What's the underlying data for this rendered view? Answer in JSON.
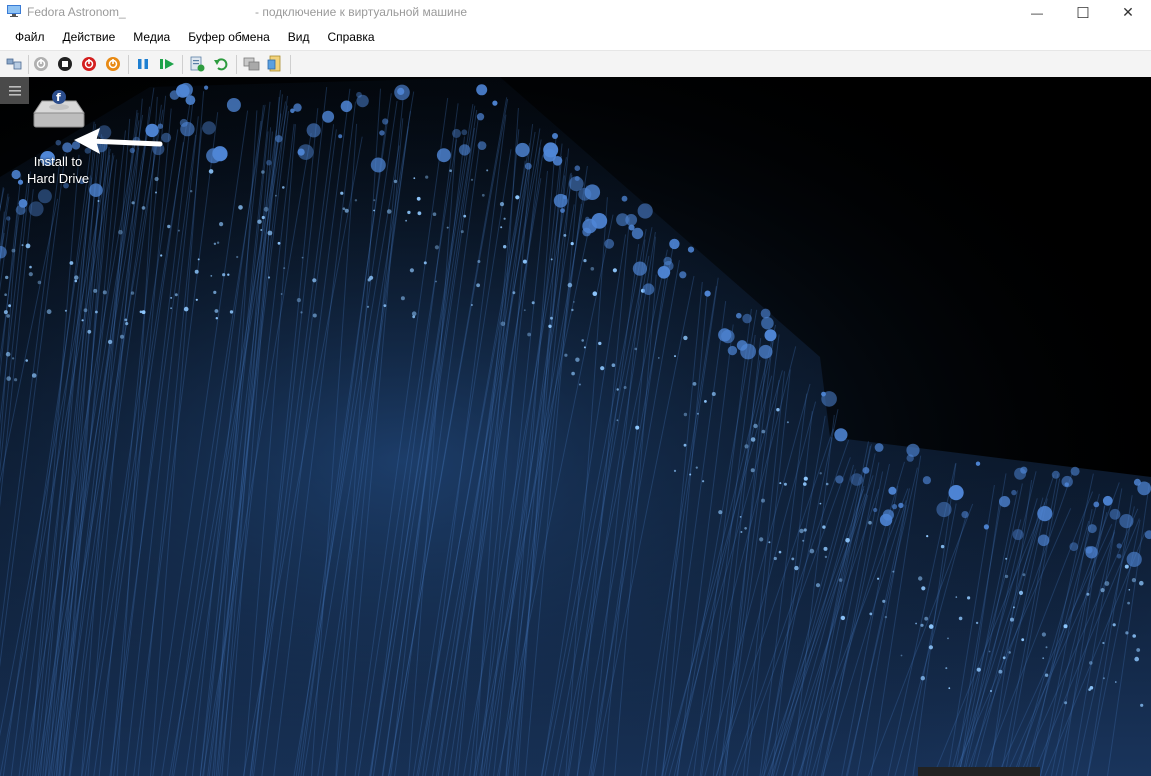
{
  "window": {
    "title_main": "Fedora Astronom_",
    "title_sub": "- подключение к виртуальной машине",
    "controls": {
      "minimize": "—",
      "maximize": "☐",
      "close": "✕"
    }
  },
  "menu": [
    "Файл",
    "Действие",
    "Медиа",
    "Буфер обмена",
    "Вид",
    "Справка"
  ],
  "toolbar": {
    "icons": [
      "ctrl-alt-del-icon",
      "start-icon",
      "turn-off-icon",
      "shut-down-icon",
      "save-state-icon",
      "pause-icon",
      "resume-icon",
      "checkpoint-icon",
      "revert-icon",
      "enhanced-session-icon",
      "share-icon"
    ]
  },
  "desktop": {
    "icon_label_line1": "Install to",
    "icon_label_line2": "Hard Drive",
    "background_color": "#000000",
    "accent_color": "#3b74c9"
  }
}
